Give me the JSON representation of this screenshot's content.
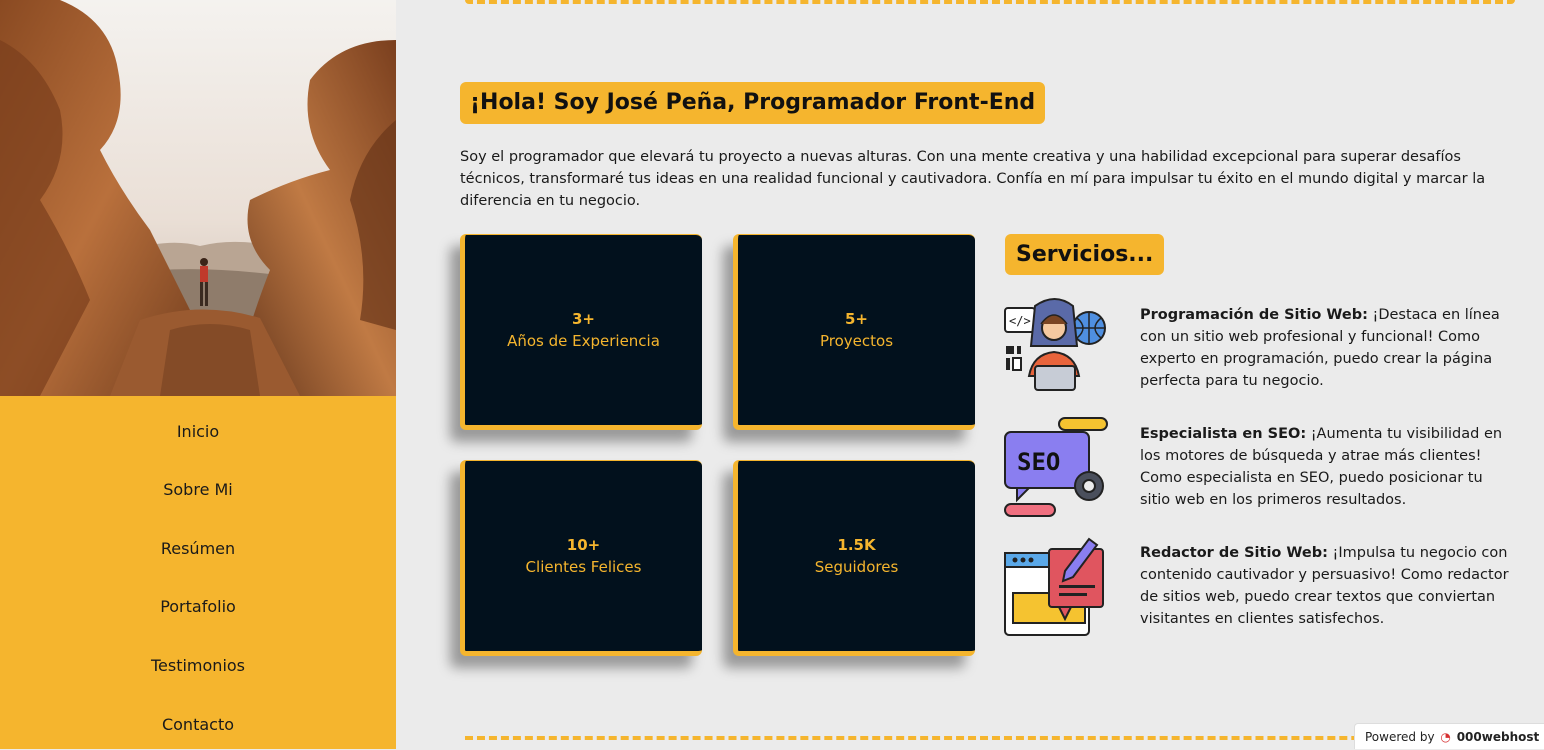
{
  "nav": {
    "items": [
      "Inicio",
      "Sobre Mi",
      "Resúmen",
      "Portafolio",
      "Testimonios",
      "Contacto"
    ]
  },
  "main": {
    "title": "¡Hola! Soy José Peña, Programador Front-End",
    "intro": "Soy el programador que elevará tu proyecto a nuevas alturas. Con una mente creativa y una habilidad excepcional para superar desafíos técnicos, transformaré tus ideas en una realidad funcional y cautivadora. Confía en mí para impulsar tu éxito en el mundo digital y marcar la diferencia en tu negocio."
  },
  "stats": [
    {
      "value": "3+",
      "label": "Años de Experiencia"
    },
    {
      "value": "5+",
      "label": "Proyectos"
    },
    {
      "value": "10+",
      "label": "Clientes Felices"
    },
    {
      "value": "1.5K",
      "label": "Seguidores"
    }
  ],
  "services": {
    "title": "Servicios...",
    "items": [
      {
        "name": "Programación de Sitio Web:",
        "text": " ¡Destaca en línea con un sitio web profesional y funcional! Como experto en programación, puedo crear la página perfecta para tu negocio.",
        "icon": "developer-icon"
      },
      {
        "name": "Especialista en SEO:",
        "text": " ¡Aumenta tu visibilidad en los motores de búsqueda y atrae más clientes! Como especialista en SEO, puedo posicionar tu sitio web en los primeros resultados.",
        "icon": "seo-icon"
      },
      {
        "name": "Redactor de Sitio Web:",
        "text": " ¡Impulsa tu negocio con contenido cautivador y persuasivo! Como redactor de sitios web, puedo crear textos que conviertan visitantes en clientes satisfechos.",
        "icon": "copywriter-icon"
      }
    ]
  },
  "badge": {
    "prefix": "Powered by",
    "brand": "000webhost"
  },
  "colors": {
    "accent": "#f5b52e",
    "card": "#02111d",
    "background": "#ebebeb"
  }
}
